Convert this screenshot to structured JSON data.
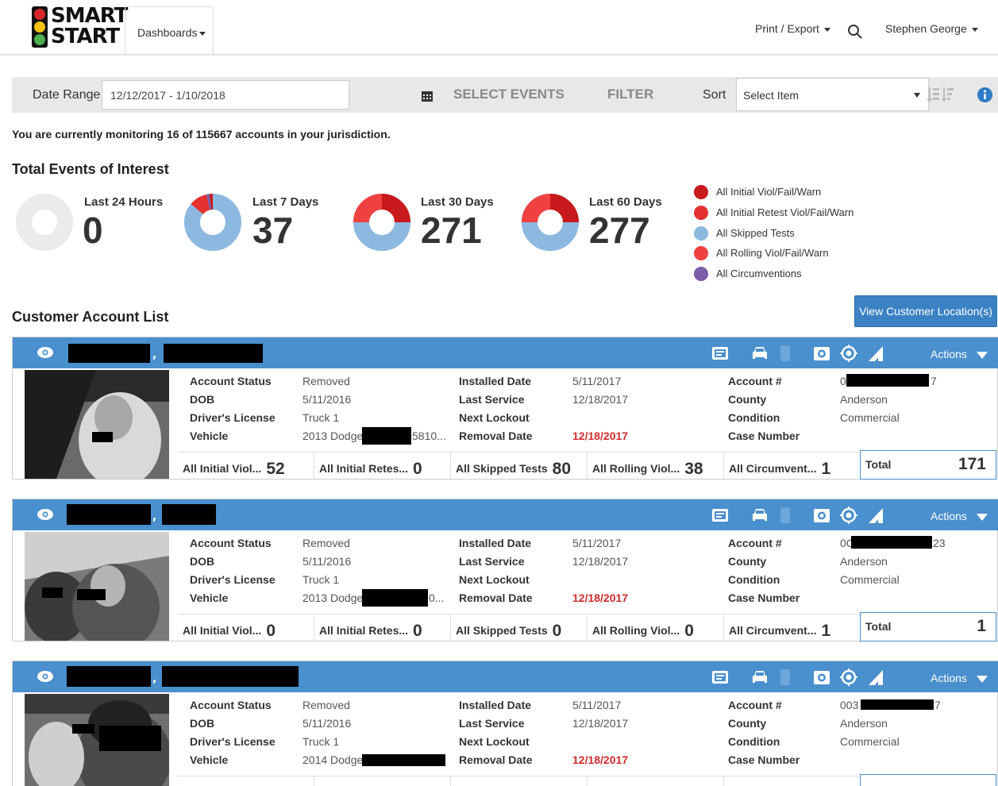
{
  "header": {
    "logo_line1": "SMART",
    "logo_line2": "START",
    "dashboards": "Dashboards",
    "print_export": "Print / Export",
    "user": "Stephen George"
  },
  "filters": {
    "date_range_label": "Date Range",
    "date_range_value": "12/12/2017 - 1/10/2018",
    "select_events": "SELECT EVENTS",
    "filter": "FILTER",
    "sort_label": "Sort",
    "sort_value": "Select Item"
  },
  "monitoring_text": "You are currently monitoring 16 of 115667 accounts in your jurisdiction.",
  "events_title": "Total Events of Interest",
  "summary": [
    {
      "label": "Last 24 Hours",
      "value": "0"
    },
    {
      "label": "Last 7 Days",
      "value": "37"
    },
    {
      "label": "Last 30 Days",
      "value": "271"
    },
    {
      "label": "Last 60 Days",
      "value": "277"
    }
  ],
  "legend": [
    {
      "label": "All Initial Viol/Fail/Warn",
      "color": "#c8191c"
    },
    {
      "label": "All Initial Retest Viol/Fail/Warn",
      "color": "#e5312f"
    },
    {
      "label": "All Skipped Tests",
      "color": "#8db9e0"
    },
    {
      "label": "All Rolling Viol/Fail/Warn",
      "color": "#ef4141"
    },
    {
      "label": "All Circumventions",
      "color": "#7b5ea7"
    }
  ],
  "list_title": "Customer Account List",
  "view_locations": "View Customer Location(s)",
  "labels": {
    "account_status": "Account Status",
    "dob": "DOB",
    "drivers_license": "Driver's License",
    "vehicle": "Vehicle",
    "installed_date": "Installed Date",
    "last_service": "Last Service",
    "next_lockout": "Next Lockout",
    "removal_date": "Removal Date",
    "account_num": "Account #",
    "county": "County",
    "condition": "Condition",
    "case_number": "Case Number",
    "actions": "Actions",
    "initial_viol": "All Initial Viol...",
    "initial_retest": "All Initial Retes...",
    "skipped": "All Skipped Tests",
    "rolling": "All Rolling Viol...",
    "circumvent": "All Circumvent...",
    "total": "Total"
  },
  "accounts": [
    {
      "status": "Removed",
      "dob": "5/11/2016",
      "license": "Truck 1",
      "vehicle": "2013 Dodge",
      "vehicle_suffix": "5810...",
      "installed": "5/11/2017",
      "last_service": "12/18/2017",
      "next_lockout": "",
      "removal": "12/18/2017",
      "account_prefix": "0",
      "account_suffix": "7",
      "county": "Anderson",
      "condition": "Commercial",
      "case_number": "",
      "initial_viol": "52",
      "initial_retest": "0",
      "skipped": "80",
      "rolling": "38",
      "circumvent": "1",
      "total": "171"
    },
    {
      "status": "Removed",
      "dob": "5/11/2016",
      "license": "Truck 1",
      "vehicle": "2013 Dodge",
      "vehicle_suffix": "0...",
      "installed": "5/11/2017",
      "last_service": "12/18/2017",
      "next_lockout": "",
      "removal": "12/18/2017",
      "account_prefix": "0C",
      "account_suffix": "23",
      "county": "Anderson",
      "condition": "Commercial",
      "case_number": "",
      "initial_viol": "0",
      "initial_retest": "0",
      "skipped": "0",
      "rolling": "0",
      "circumvent": "1",
      "total": "1"
    },
    {
      "status": "Removed",
      "dob": "5/11/2016",
      "license": "Truck 1",
      "vehicle": "2014 Dodge",
      "vehicle_suffix": "",
      "installed": "5/11/2017",
      "last_service": "12/18/2017",
      "next_lockout": "",
      "removal": "12/18/2017",
      "account_prefix": "003",
      "account_suffix": "7",
      "county": "Anderson",
      "condition": "Commercial",
      "case_number": ""
    }
  ]
}
